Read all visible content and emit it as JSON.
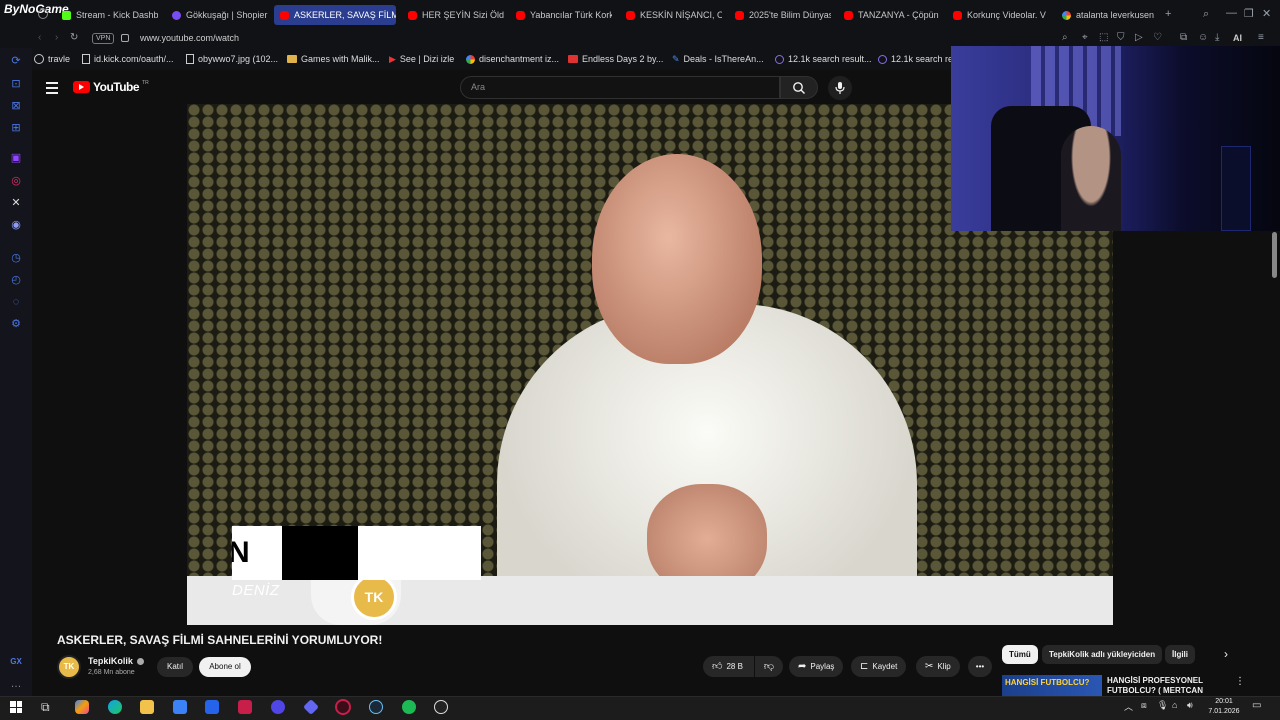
{
  "browser": {
    "brand": "ByNoGame",
    "url": "www.youtube.com/watch",
    "vpn_label": "VPN",
    "tabs": [
      {
        "label": "Stream - Kick Dashbo",
        "icon": "kick"
      },
      {
        "label": "Gökkuşağı | Shopier",
        "icon": "shopier"
      },
      {
        "label": "ASKERLER, SAVAŞ FİLMİ",
        "icon": "youtube",
        "active": true
      },
      {
        "label": "HER ŞEYİN Sizi Öldü",
        "icon": "youtube"
      },
      {
        "label": "Yabancılar Türk Kork",
        "icon": "youtube"
      },
      {
        "label": "KESKİN NİŞANCI, OY",
        "icon": "youtube"
      },
      {
        "label": "2025'te Bilim Dünyas",
        "icon": "youtube"
      },
      {
        "label": "TANZANYA - Çöpün",
        "icon": "youtube"
      },
      {
        "label": "Korkunç Videolar. V",
        "icon": "youtube"
      },
      {
        "label": "atalanta leverkusen",
        "icon": "google"
      }
    ],
    "bookmarks": [
      {
        "label": "travle"
      },
      {
        "label": "id.kick.com/oauth/..."
      },
      {
        "label": "obywwo7.jpg (102..."
      },
      {
        "label": "Games with Malik..."
      },
      {
        "label": "See | Dizi izle"
      },
      {
        "label": "disenchantment iz..."
      },
      {
        "label": "Endless Days 2 by..."
      },
      {
        "label": "Deals - IsThereAn..."
      },
      {
        "label": "12.1k search result..."
      },
      {
        "label": "12.1k search res"
      }
    ],
    "ai_label": "AI"
  },
  "youtube": {
    "logo_text": "YouTube",
    "logo_region": "TR",
    "search_placeholder": "Ara",
    "video_overlay": {
      "tk_logo": "TK",
      "lower_third_text": "N",
      "lower_third_subtitle": "DENİZ"
    },
    "video_title": "ASKERLER, SAVAŞ FİLMİ SAHNELERİNİ YORUMLUYOR!",
    "channel": {
      "avatar_text": "TK",
      "name": "TepkiKolik",
      "subscribers": "2,68 Mn abone"
    },
    "join_label": "Katıl",
    "subscribe_label": "Abone ol",
    "like_count": "28 B",
    "share_label": "Paylaş",
    "save_label": "Kaydet",
    "clip_label": "Klip",
    "chips": [
      {
        "label": "Tümü"
      },
      {
        "label": "TepkiKolik adlı yükleyiciden"
      },
      {
        "label": "İlgili"
      }
    ],
    "recommendation": {
      "thumb_text": "HANGİSİ FUTBOLCU?",
      "title": "HANGİSİ PROFESYONEL FUTBOLCU? ( MERTCAN"
    }
  },
  "taskbar": {
    "time": "20:01",
    "date": "7.01.2026"
  },
  "colors": {
    "youtube_red": "#ff0000",
    "active_tab": "#2a3d8f",
    "opera_accent": "#4b78e6",
    "kick_green": "#53fc18",
    "spotify_green": "#1db954"
  }
}
